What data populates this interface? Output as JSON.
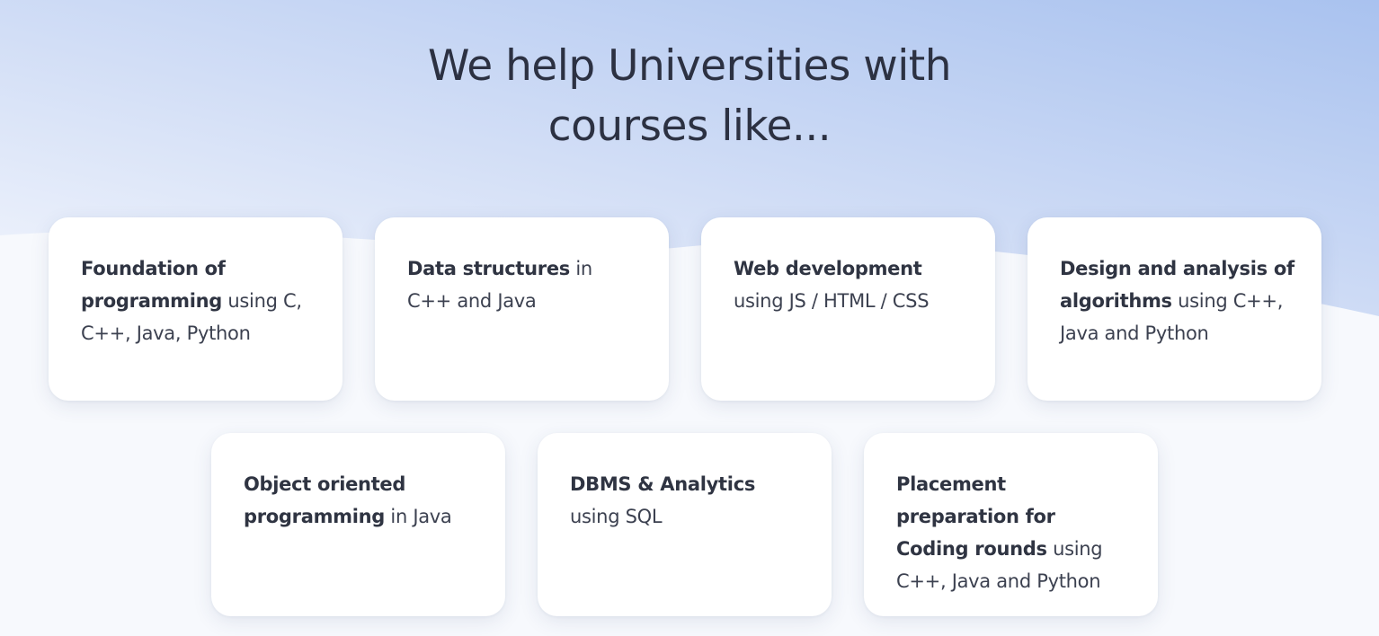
{
  "heading": {
    "line1": "We help Universities with",
    "line2": "courses like..."
  },
  "courses": [
    {
      "title": "Foundation of programming",
      "detail": " using C, C++, Java, Python"
    },
    {
      "title": "Data structures",
      "detail": " in C++ and Java"
    },
    {
      "title": "Web development",
      "detail": " using JS / HTML / CSS"
    },
    {
      "title": "Design and analysis of algorithms",
      "detail": " using C++, Java and Python"
    },
    {
      "title": "Object oriented programming",
      "detail": " in Java"
    },
    {
      "title": "DBMS & Analytics",
      "detail": " using SQL"
    },
    {
      "title": "Placement preparation for Coding rounds",
      "detail": " using C++, Java and Python"
    }
  ],
  "colors": {
    "gradient_blue": "#aec6f0",
    "background": "#f7f9fd",
    "card": "#ffffff",
    "heading_text": "#2c3142"
  }
}
